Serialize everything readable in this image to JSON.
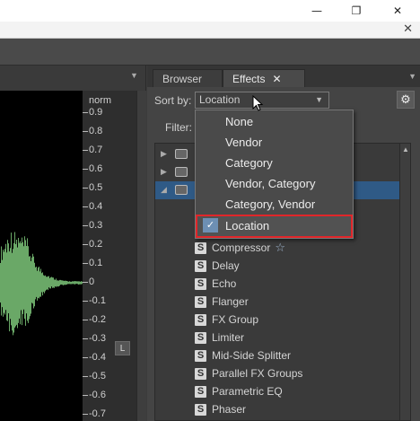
{
  "window": {
    "minimize_glyph": "—",
    "maximize_glyph": "❐",
    "close_glyph": "✕",
    "doc_close_glyph": "✕"
  },
  "left_panel": {
    "unit_label": "norm",
    "ticks": [
      "0.9",
      "0.8",
      "0.7",
      "0.6",
      "0.5",
      "0.4",
      "0.3",
      "0.2",
      "0.1",
      "0",
      "-0.1",
      "-0.2",
      "-0.3",
      "-0.4",
      "-0.5",
      "-0.6",
      "-0.7"
    ],
    "channel_button": "L",
    "waveform_color": "#6aa867"
  },
  "tabs": {
    "browser": "Browser",
    "effects": "Effects",
    "effects_close": "✕"
  },
  "sort": {
    "label": "Sort by:",
    "value": "Location"
  },
  "filter": {
    "label": "Filter:"
  },
  "dropdown": {
    "options": [
      "None",
      "Vendor",
      "Category",
      "Vendor, Category",
      "Category, Vendor",
      "Location"
    ],
    "selected_label": "Location",
    "check_glyph": "✓",
    "highlight_color": "#e0262a"
  },
  "effects": [
    {
      "label": "Compressor",
      "favorite": "☆"
    },
    {
      "label": "Delay"
    },
    {
      "label": "Echo"
    },
    {
      "label": "Flanger"
    },
    {
      "label": "FX Group"
    },
    {
      "label": "Limiter"
    },
    {
      "label": "Mid-Side Splitter"
    },
    {
      "label": "Parallel FX Groups"
    },
    {
      "label": "Parametric EQ"
    },
    {
      "label": "Phaser"
    }
  ],
  "effect_icon_letter": "S"
}
